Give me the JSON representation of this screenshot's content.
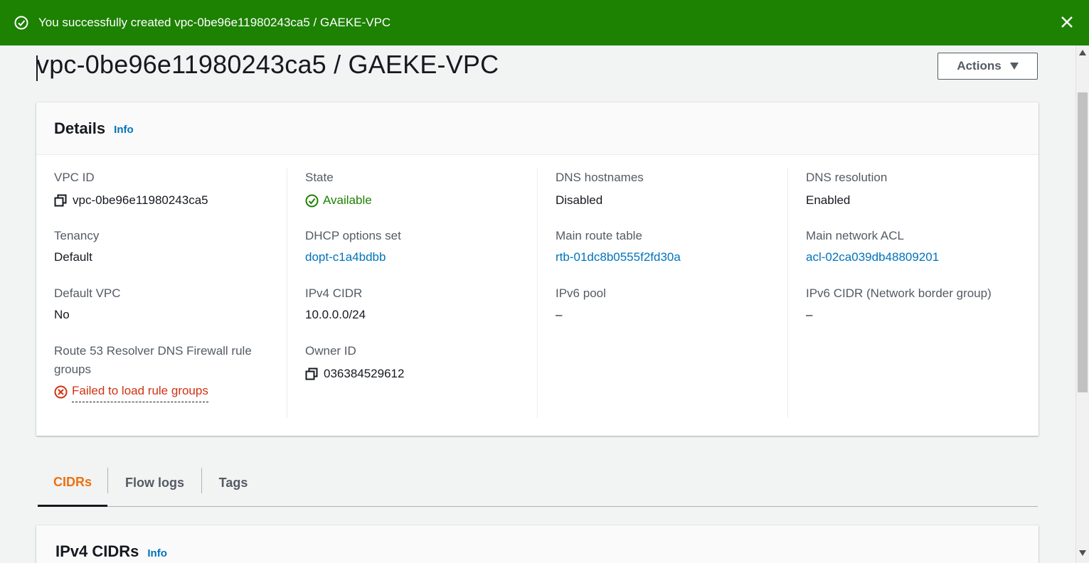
{
  "flash": {
    "message": "You successfully created vpc-0be96e11980243ca5 / GAEKE-VPC"
  },
  "header": {
    "title": "vpc-0be96e11980243ca5 / GAEKE-VPC",
    "actions_label": "Actions"
  },
  "details": {
    "title": "Details",
    "info": "Info",
    "col1": {
      "vpc_id_label": "VPC ID",
      "vpc_id_value": "vpc-0be96e11980243ca5",
      "tenancy_label": "Tenancy",
      "tenancy_value": "Default",
      "default_vpc_label": "Default VPC",
      "default_vpc_value": "No",
      "route53_label_line1": "Route 53 Resolver DNS Firewall rule",
      "route53_label_line2": "groups",
      "route53_value": "Failed to load rule groups"
    },
    "col2": {
      "state_label": "State",
      "state_value": "Available",
      "dhcp_label": "DHCP options set",
      "dhcp_value": "dopt-c1a4bdbb",
      "ipv4_label": "IPv4 CIDR",
      "ipv4_value": "10.0.0.0/24",
      "owner_label": "Owner ID",
      "owner_value": "036384529612"
    },
    "col3": {
      "dns_hostnames_label": "DNS hostnames",
      "dns_hostnames_value": "Disabled",
      "main_route_label": "Main route table",
      "main_route_value": "rtb-01dc8b0555f2fd30a",
      "ipv6_pool_label": "IPv6 pool",
      "ipv6_pool_value": "–"
    },
    "col4": {
      "dns_resolution_label": "DNS resolution",
      "dns_resolution_value": "Enabled",
      "main_acl_label": "Main network ACL",
      "main_acl_value": "acl-02ca039db48809201",
      "ipv6_cidr_label": "IPv6 CIDR (Network border group)",
      "ipv6_cidr_value": "–"
    }
  },
  "tabs": {
    "cidrs": "CIDRs",
    "flow_logs": "Flow logs",
    "tags": "Tags"
  },
  "ipv4_section": {
    "title": "IPv4 CIDRs",
    "info": "Info"
  },
  "colors": {
    "success": "#1d8102",
    "link": "#0073bb",
    "error": "#d13212",
    "active_tab": "#ec7211"
  }
}
